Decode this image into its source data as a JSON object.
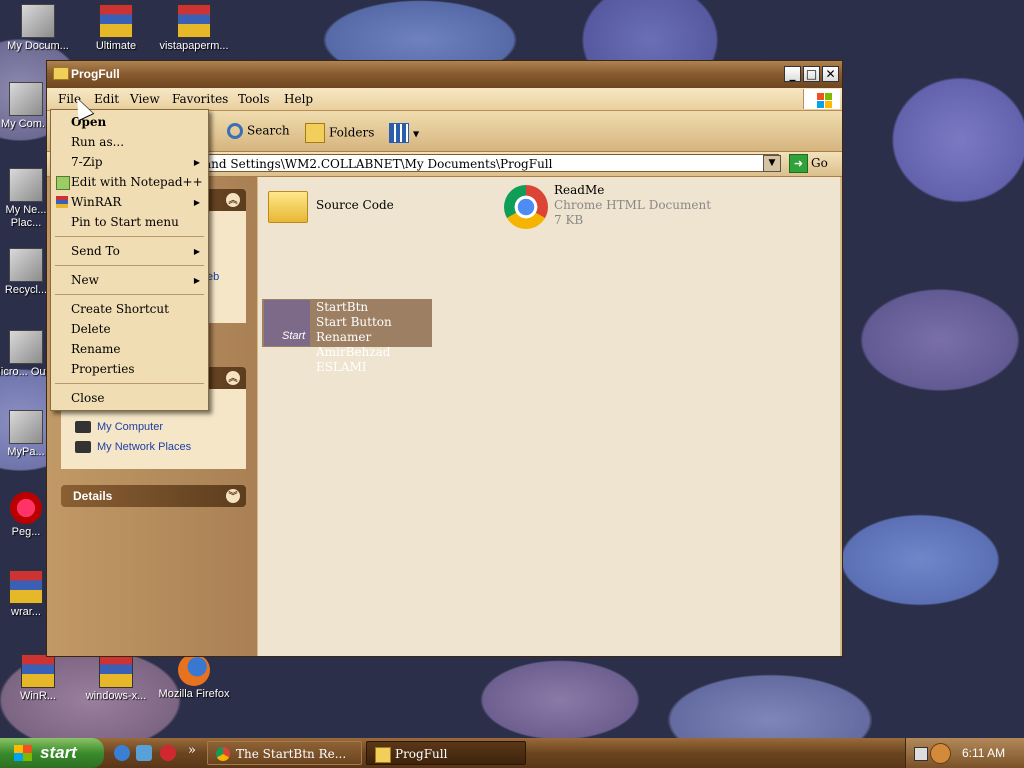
{
  "desktop": {
    "icons": [
      {
        "label": "My Docum..."
      },
      {
        "label": "Ultimate"
      },
      {
        "label": "vistapaperm..."
      },
      {
        "label": "My Com..."
      },
      {
        "label": "My Ne... Plac..."
      },
      {
        "label": "Recycl..."
      },
      {
        "label": "Micro... Outl..."
      },
      {
        "label": "MyPa..."
      },
      {
        "label": "Peg..."
      },
      {
        "label": "wrar..."
      },
      {
        "label": "WinR..."
      },
      {
        "label": "windows-x..."
      },
      {
        "label": "Mozilla Firefox"
      }
    ]
  },
  "window": {
    "title": "ProgFull",
    "controls": {
      "minimize": "_",
      "maximize": "□",
      "close": "✕"
    },
    "menu": [
      "File",
      "Edit",
      "View",
      "Favorites",
      "Tools",
      "Help"
    ],
    "toolbar": {
      "search": "Search",
      "folders": "Folders"
    },
    "address": {
      "value": "and Settings\\WM2.COLLABNET\\My Documents\\ProgFull",
      "go": "Go"
    },
    "left_pane": {
      "panel1_partial_link": "eb",
      "links": [
        "My Computer",
        "My Network Places"
      ],
      "details_title": "Details"
    },
    "files": [
      {
        "name": "Source Code",
        "type": "",
        "size": ""
      },
      {
        "name": "ReadMe",
        "type": "Chrome HTML Document",
        "size": "7 KB"
      },
      {
        "name": "StartBtn",
        "type": "Start Button Renamer",
        "author": "AmirBehzad ESLAMI"
      }
    ]
  },
  "file_menu": {
    "items": [
      {
        "label": "Open",
        "bold": true
      },
      {
        "label": "Run as..."
      },
      {
        "label": "7-Zip",
        "submenu": true
      },
      {
        "label": "Edit with Notepad++"
      },
      {
        "label": "WinRAR",
        "submenu": true
      },
      {
        "label": "Pin to Start menu"
      },
      {
        "label": "Send To",
        "submenu": true
      },
      {
        "label": "New",
        "submenu": true
      },
      {
        "label": "Create Shortcut"
      },
      {
        "label": "Delete"
      },
      {
        "label": "Rename"
      },
      {
        "label": "Properties"
      },
      {
        "label": "Close"
      }
    ]
  },
  "taskbar": {
    "start_label": "start",
    "overflow": "»",
    "tasks": [
      {
        "label": "The StartBtn Re..."
      },
      {
        "label": "ProgFull"
      }
    ],
    "clock": "6:11 AM"
  }
}
